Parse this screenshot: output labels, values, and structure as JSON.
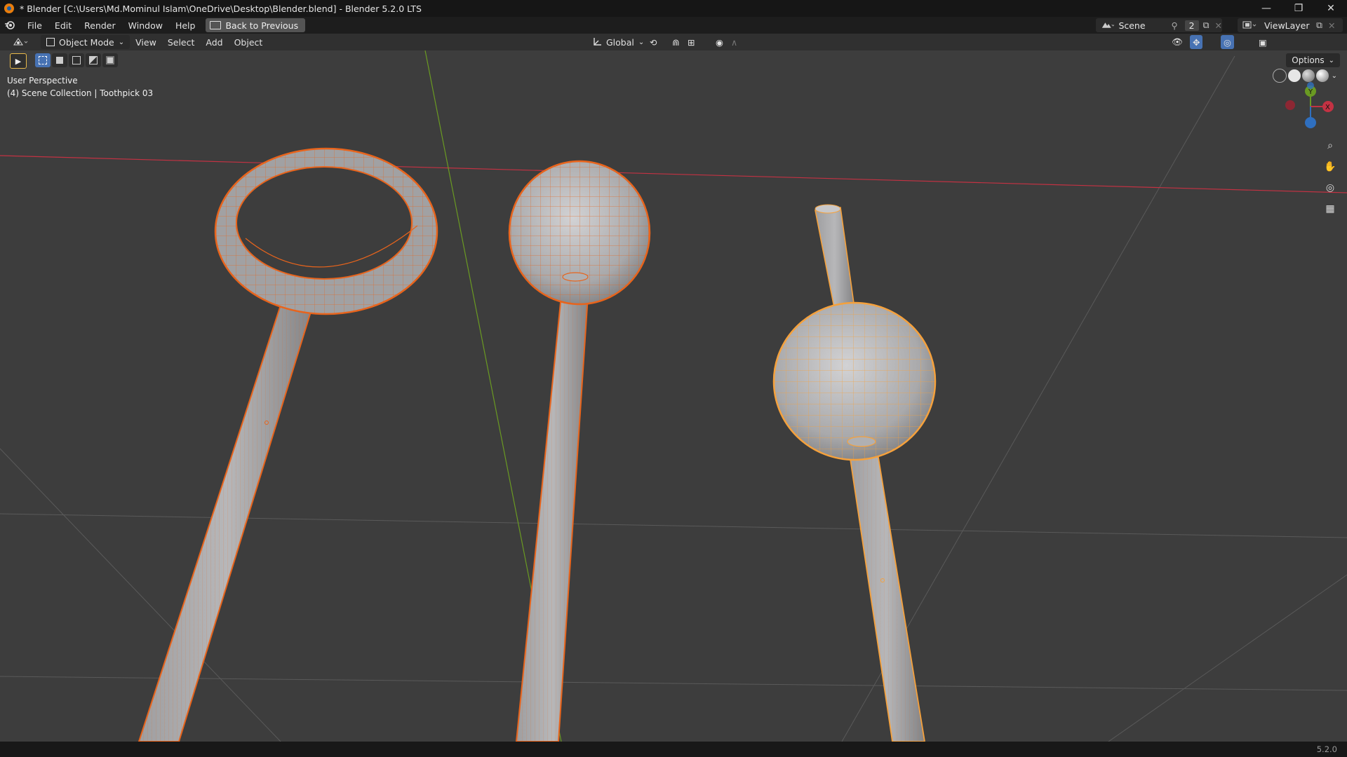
{
  "window": {
    "title": "* Blender [C:\\Users\\Md.Mominul Islam\\OneDrive\\Desktop\\Blender.blend] - Blender 5.2.0 LTS",
    "minimize": "—",
    "maximize": "❐",
    "close": "✕"
  },
  "menubar": {
    "items": [
      "File",
      "Edit",
      "Render",
      "Window",
      "Help"
    ],
    "back_label": "Back to Previous",
    "scene_label": "Scene",
    "scene_count": "2",
    "viewlayer_label": "ViewLayer"
  },
  "header3d": {
    "mode_label": "Object Mode",
    "menus": [
      "View",
      "Select",
      "Add",
      "Object"
    ],
    "orientation_label": "Global",
    "options_label": "Options"
  },
  "viewport": {
    "perspective_label": "User Perspective",
    "collection_label": "(4) Scene Collection | Toothpick 03",
    "gizmo_axes": [
      "X",
      "Y",
      "Z"
    ],
    "accent_colors": {
      "x_axis": "#c33243",
      "y_axis": "#6a9a22",
      "z_axis": "#2f6fbf",
      "selected_active": "#f5a13c",
      "selected": "#e8641c"
    },
    "objects": [
      "ring-handle-toothpick",
      "ball-toothpick",
      "ball-toothpick-03"
    ]
  },
  "statusbar": {
    "version": "5.2.0"
  }
}
